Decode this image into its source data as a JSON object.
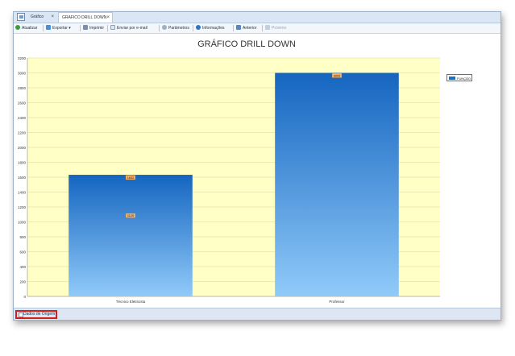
{
  "tabs": [
    {
      "label": "Gráfico",
      "close": "×"
    },
    {
      "label": "GRAFICO DRILL DOWN",
      "close": "×"
    }
  ],
  "toolbar": {
    "atualizar": "Atualizar",
    "exportar": "Exportar",
    "imprimir": "Imprimir",
    "enviar": "Enviar por e-mail",
    "parametros": "Parâmetros",
    "informacoes": "Informações",
    "anterior": "Anterior",
    "proximo": "Próximo"
  },
  "legend": {
    "label": "FUNÇÃO"
  },
  "statusbar": {
    "dados_label": "Dados de Origem"
  },
  "chart_data": {
    "type": "bar",
    "title": "GRÁFICO DRILL DOWN",
    "categories": [
      "Técnico Eletricista",
      "Professor"
    ],
    "series": [
      {
        "name": "FUNÇÃO",
        "values": [
          1632,
          3000
        ]
      }
    ],
    "extra_labels": [
      {
        "category": "Técnico Eletricista",
        "value": 1120
      }
    ],
    "ylim": [
      0,
      3200
    ],
    "yticks": [
      0,
      200,
      400,
      600,
      800,
      1000,
      1200,
      1400,
      1600,
      1800,
      2000,
      2200,
      2400,
      2600,
      2800,
      3000,
      3200
    ],
    "grid": true,
    "legend_position": "top-right",
    "colors": {
      "plot_bg": "#ffffc6",
      "bar_top": "#1565c0",
      "bar_bottom": "#90caf9",
      "label_bg": "#f6b26b"
    }
  }
}
